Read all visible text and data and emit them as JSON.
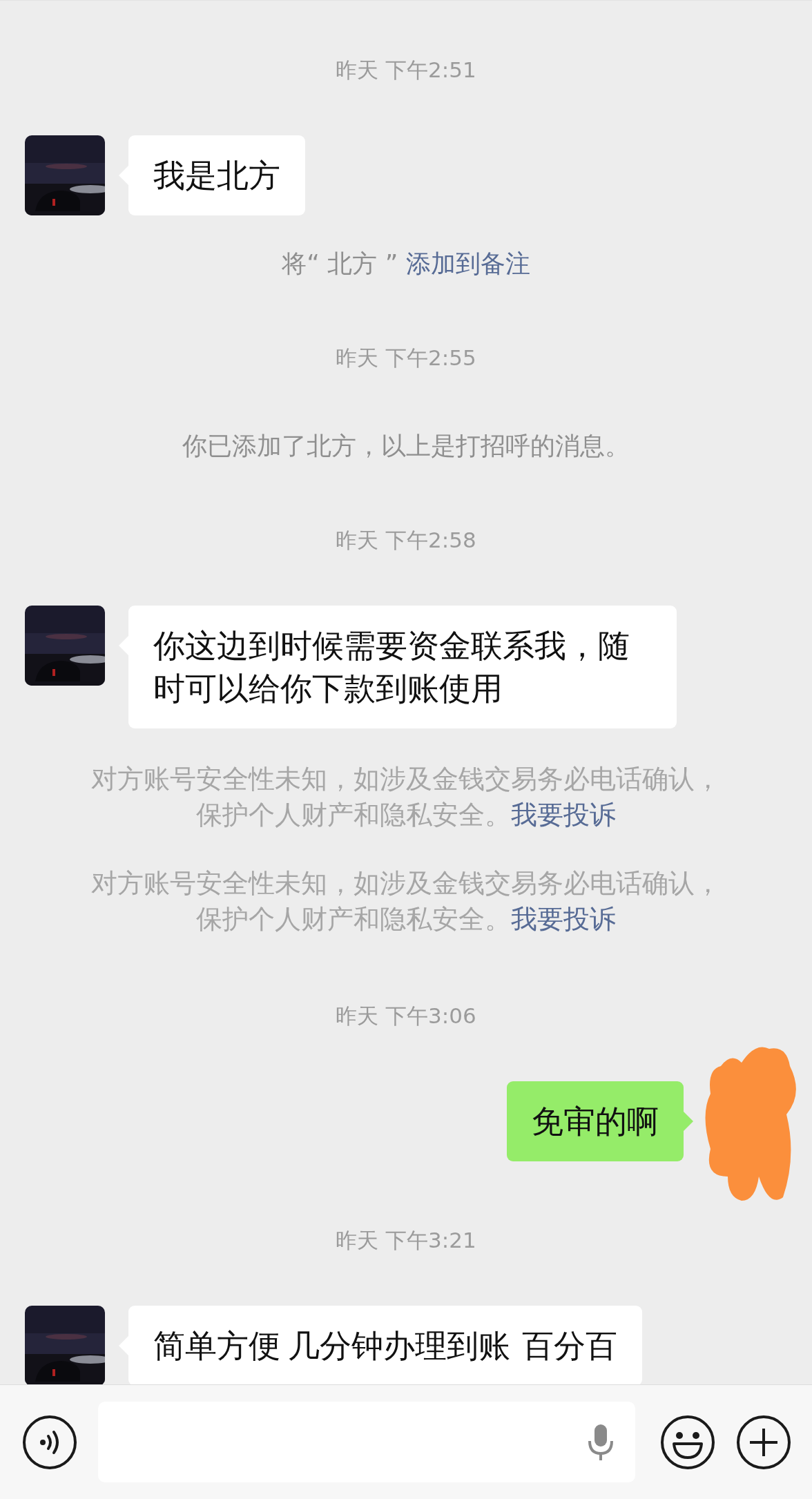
{
  "messages": [
    {
      "kind": "time",
      "text": "昨天 下午2:51"
    },
    {
      "kind": "incoming",
      "text": "我是北方"
    },
    {
      "kind": "note",
      "text": "将“ 北方 ” ",
      "link": "添加到备注"
    },
    {
      "kind": "time",
      "text": "昨天 下午2:55"
    },
    {
      "kind": "system",
      "text": "你已添加了北方，以上是打招呼的消息。"
    },
    {
      "kind": "time",
      "text": "昨天 下午2:58"
    },
    {
      "kind": "incoming",
      "text": "你这边到时候需要资金联系我，随时可以给你下款到账使用"
    },
    {
      "kind": "warning",
      "text": "对方账号安全性未知，如涉及金钱交易务必电话确认，保护个人财产和隐私安全。",
      "link": "我要投诉"
    },
    {
      "kind": "warning",
      "text": "对方账号安全性未知，如涉及金钱交易务必电话确认，保护个人财产和隐私安全。",
      "link": "我要投诉"
    },
    {
      "kind": "time",
      "text": "昨天 下午3:06"
    },
    {
      "kind": "outgoing",
      "text": "免审的啊"
    },
    {
      "kind": "time",
      "text": "昨天 下午3:21"
    },
    {
      "kind": "incoming",
      "text": "简单方便  几分钟办理到账   百分百"
    }
  ]
}
